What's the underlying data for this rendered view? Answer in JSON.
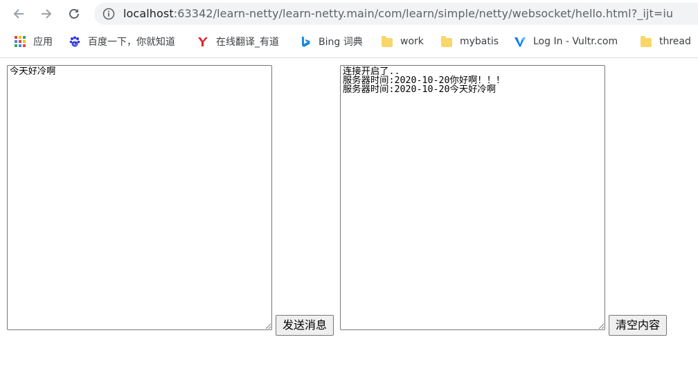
{
  "browser": {
    "url_host": "localhost",
    "url_rest": ":63342/learn-netty/learn-netty.main/com/learn/simple/netty/websocket/hello.html?_ijt=iu",
    "bookmarks": [
      {
        "label": "应用",
        "icon": "apps-grid-icon"
      },
      {
        "label": "百度一下，你就知道",
        "icon": "baidu-paw-icon"
      },
      {
        "label": "在线翻译_有道",
        "icon": "youdao-logo-icon"
      },
      {
        "label": "Bing 词典",
        "icon": "bing-logo-icon"
      },
      {
        "label": "work",
        "icon": "folder-icon"
      },
      {
        "label": "mybatis",
        "icon": "folder-icon"
      },
      {
        "label": "Log In - Vultr.com",
        "icon": "vultr-logo-icon"
      },
      {
        "label": "thread",
        "icon": "folder-icon"
      }
    ]
  },
  "page": {
    "message_input": {
      "value": "今天好冷啊"
    },
    "send_button": {
      "label": "发送消息"
    },
    "response_output": {
      "value": "连接开启了..\n服务器时间:2020-10-20你好啊！！！\n服务器时间:2020-10-20今天好冷啊"
    },
    "clear_button": {
      "label": "清空内容"
    }
  },
  "colors": {
    "omnibox_bg": "#f1f3f4",
    "folder": "#f8d667",
    "button_bg": "#efefef",
    "border": "#767676"
  }
}
